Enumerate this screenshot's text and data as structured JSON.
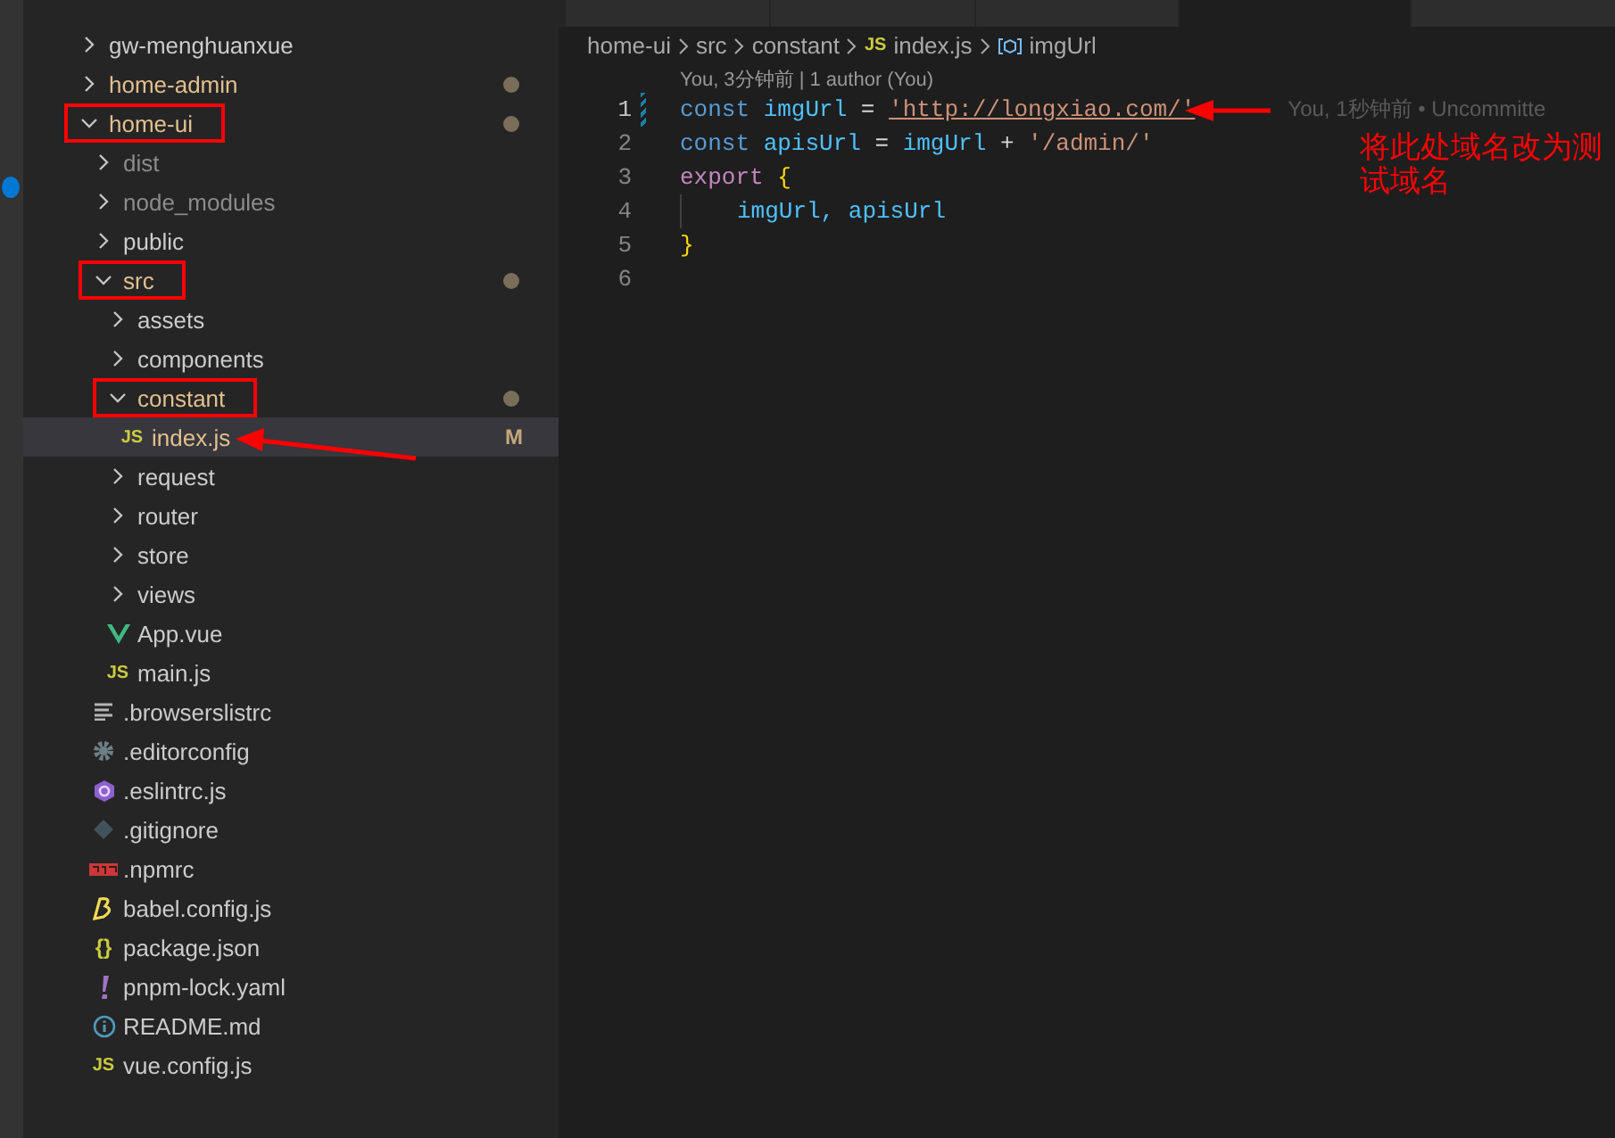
{
  "explorer": {
    "items": [
      {
        "name": "gw-menghuanxue",
        "kind": "folder",
        "expanded": false
      },
      {
        "name": "home-admin",
        "kind": "folder",
        "expanded": false,
        "color": "#e2c08d",
        "dot": true
      },
      {
        "name": "home-ui",
        "kind": "folder",
        "expanded": true,
        "color": "#e2c08d",
        "dot": true,
        "highlighted": true,
        "children": [
          {
            "name": "dist",
            "kind": "folder",
            "expanded": false,
            "color": "#8c8c8c"
          },
          {
            "name": "node_modules",
            "kind": "folder",
            "expanded": false,
            "color": "#8c8c8c"
          },
          {
            "name": "public",
            "kind": "folder",
            "expanded": false
          },
          {
            "name": "src",
            "kind": "folder",
            "expanded": true,
            "color": "#e2c08d",
            "dot": true,
            "highlighted": true,
            "children": [
              {
                "name": "assets",
                "kind": "folder",
                "expanded": false
              },
              {
                "name": "components",
                "kind": "folder",
                "expanded": false
              },
              {
                "name": "constant",
                "kind": "folder",
                "expanded": true,
                "color": "#e2c08d",
                "dot": true,
                "highlighted": true,
                "children": [
                  {
                    "name": "index.js",
                    "kind": "js",
                    "icon_text": "JS",
                    "color": "#e2c08d",
                    "badge": "M",
                    "selected": true
                  }
                ]
              },
              {
                "name": "request",
                "kind": "folder",
                "expanded": false
              },
              {
                "name": "router",
                "kind": "folder",
                "expanded": false
              },
              {
                "name": "store",
                "kind": "folder",
                "expanded": false
              },
              {
                "name": "views",
                "kind": "folder",
                "expanded": false
              },
              {
                "name": "App.vue",
                "kind": "vue",
                "selected": false
              },
              {
                "name": "main.js",
                "kind": "js",
                "icon_text": "JS",
                "selected": false
              }
            ]
          },
          {
            "name": ".browserslistrc",
            "kind": "lines",
            "selected": false
          },
          {
            "name": ".editorconfig",
            "kind": "gear",
            "selected": false
          },
          {
            "name": ".eslintrc.js",
            "kind": "hexagon",
            "selected": false
          },
          {
            "name": ".gitignore",
            "kind": "diamond",
            "selected": false
          },
          {
            "name": ".npmrc",
            "kind": "npm",
            "selected": false
          },
          {
            "name": "babel.config.js",
            "kind": "babel",
            "selected": false
          },
          {
            "name": "package.json",
            "kind": "json",
            "icon_text": "{}",
            "selected": false
          },
          {
            "name": "pnpm-lock.yaml",
            "kind": "exclamation",
            "selected": false
          },
          {
            "name": "README.md",
            "kind": "info",
            "selected": false
          },
          {
            "name": "vue.config.js",
            "kind": "js",
            "icon_text": "JS",
            "selected": false
          }
        ]
      }
    ]
  },
  "editor": {
    "tabs": [
      {
        "selected": false
      },
      {
        "selected": false
      },
      {
        "selected": false
      },
      {
        "selected": true
      },
      {
        "selected": false
      }
    ],
    "breadcrumb": [
      {
        "label": "home-ui",
        "kind": "folder"
      },
      {
        "label": "src",
        "kind": "folder"
      },
      {
        "label": "constant",
        "kind": "folder"
      },
      {
        "label": "index.js",
        "kind": "js",
        "icon_text": "JS"
      },
      {
        "label": "imgUrl",
        "kind": "symbol"
      }
    ],
    "codelens": "You, 3分钟前 | 1 author (You)",
    "lines": [
      {
        "number": "1",
        "active": true,
        "modified": true,
        "tokens": [
          {
            "t": "const",
            "kind": "keyword"
          },
          {
            "t": "imgUrl",
            "kind": "const"
          },
          {
            "t": "=",
            "kind": "op"
          },
          {
            "t": "'http://longxiao.com/'",
            "kind": "link"
          }
        ],
        "blame": "You, 1秒钟前 • Uncommitte"
      },
      {
        "number": "2",
        "active": false,
        "modified": false,
        "tokens": [
          {
            "t": "const",
            "kind": "keyword"
          },
          {
            "t": "apisUrl",
            "kind": "const"
          },
          {
            "t": "=",
            "kind": "op"
          },
          {
            "t": "imgUrl",
            "kind": "const"
          },
          {
            "t": "+",
            "kind": "op"
          },
          {
            "t": "'/admin/'",
            "kind": "string"
          }
        ]
      },
      {
        "number": "3",
        "active": false,
        "modified": false,
        "tokens": [
          {
            "t": "export",
            "kind": "control"
          },
          {
            "t": "{",
            "kind": "brace"
          }
        ]
      },
      {
        "number": "4",
        "active": false,
        "modified": false,
        "indent": true,
        "tokens": [
          {
            "t": "imgUrl,",
            "kind": "const"
          },
          {
            "t": "apisUrl",
            "kind": "const"
          }
        ]
      },
      {
        "number": "5",
        "active": false,
        "modified": false,
        "tokens": [
          {
            "t": "}",
            "kind": "brace"
          }
        ]
      },
      {
        "number": "6",
        "active": false,
        "modified": false
      }
    ]
  },
  "annotation": {
    "text": "将此处域名改为测试域名"
  }
}
